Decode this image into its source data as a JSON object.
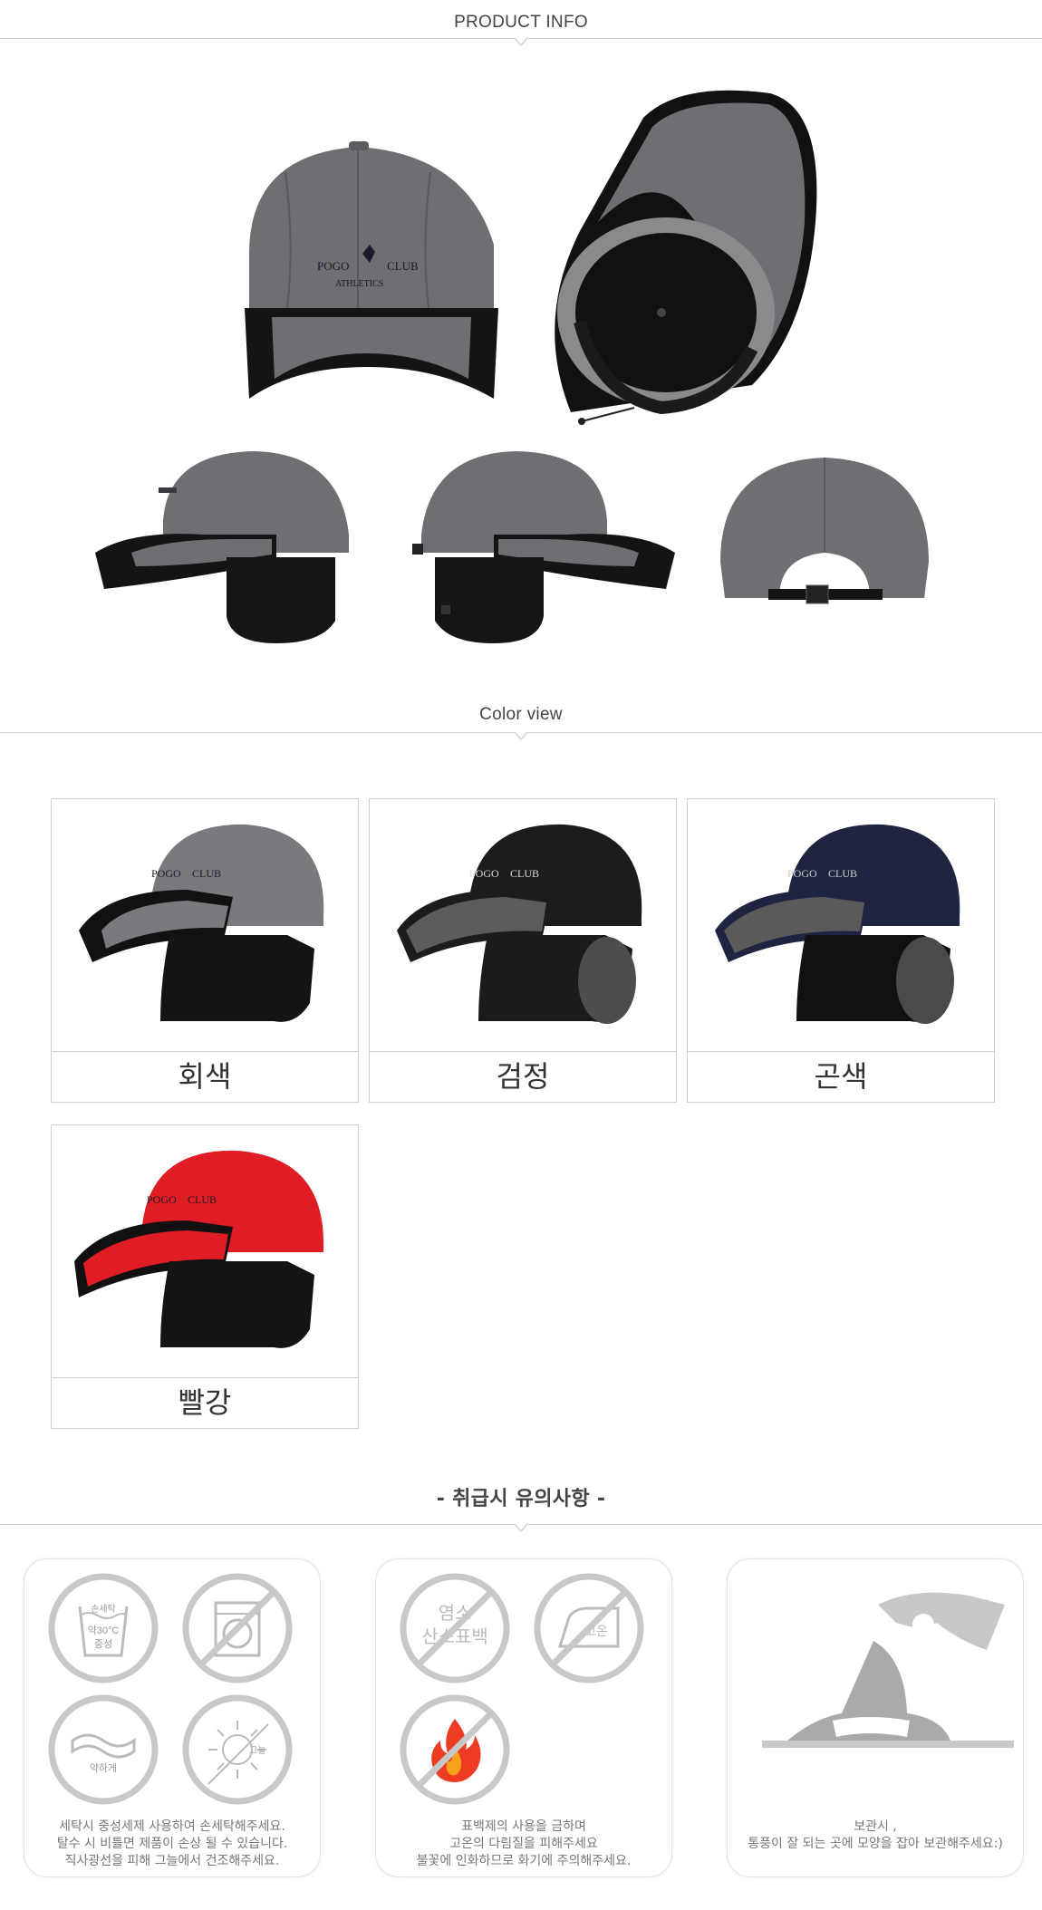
{
  "sections": {
    "product_info": "PRODUCT INFO",
    "color_view": "Color view",
    "caution": "-  취급시 유의사항 -"
  },
  "product_views": {
    "logo_line1": "POGO",
    "logo_line2": "CLUB",
    "logo_line3": "ATHLETICS"
  },
  "colors": [
    {
      "name": "회색",
      "crown": "#7a7a7e",
      "brim_top": "#7a7a7e",
      "brim_edge": "#111111",
      "flap": "#141414"
    },
    {
      "name": "검정",
      "crown": "#1d1b1c",
      "brim_top": "#5c5c5c",
      "brim_edge": "#1d1b1c",
      "flap": "#4d4d4d"
    },
    {
      "name": "곤색",
      "crown": "#1f2540",
      "brim_top": "#5a5a5a",
      "brim_edge": "#1f2540",
      "flap": "#111111"
    },
    {
      "name": "빨강",
      "crown": "#e01c24",
      "brim_top": "#e01c24",
      "brim_edge": "#111111",
      "flap": "#141414"
    }
  ],
  "care": {
    "wash_icon": {
      "line1": "손세탁",
      "line2": "약30°C",
      "line3": "중성"
    },
    "wring_icon": "약하게",
    "shade_icon": "그늘",
    "bleach_icon": {
      "line1": "염소",
      "line2": "산소표백"
    },
    "iron_icon": "고온",
    "card1": [
      "세탁시 중성세제 사용하여 손세탁해주세요.",
      "탈수 시 비틀면 제품이 손상 될 수 있습니다.",
      "직사광선을 피해 그늘에서 건조해주세요."
    ],
    "card2": [
      "표백제의 사용을 금하며",
      "고온의 다림질을 피해주세요",
      "불꽃에 인화하므로 화기에 주의해주세요."
    ],
    "card3": [
      "보관시 ,",
      "통풍이 잘 되는 곳에 모양을 잡아 보관해주세요:)"
    ]
  }
}
